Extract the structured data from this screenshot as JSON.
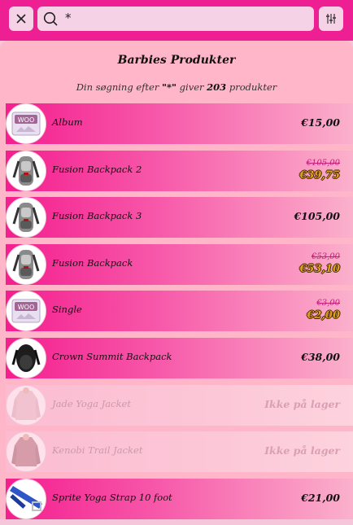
{
  "search": {
    "value": "*"
  },
  "header": {
    "title": "Barbies Produkter",
    "result_prefix": "Din søgning efter",
    "query_quoted": "\"*\"",
    "result_mid": "giver",
    "result_count": "203",
    "result_suffix": "produkter"
  },
  "products": [
    {
      "name": "Album",
      "price": "€15,00",
      "image": "woo-placeholder-image"
    },
    {
      "name": "Fusion Backpack 2",
      "old_price": "€105,00",
      "sale_price": "€39,75",
      "image": "backpack-image"
    },
    {
      "name": "Fusion Backpack 3",
      "price": "€105,00",
      "image": "backpack-image"
    },
    {
      "name": "Fusion Backpack",
      "old_price": "€53,00",
      "sale_price": "€53,10",
      "image": "backpack-image"
    },
    {
      "name": "Single",
      "old_price": "€3,00",
      "sale_price": "€2,00",
      "image": "woo-placeholder-image"
    },
    {
      "name": "Crown Summit Backpack",
      "price": "€38,00",
      "image": "black-backpack-image"
    },
    {
      "name": "Jade Yoga Jacket",
      "stock": "Ikke på lager",
      "image": "jacket-image"
    },
    {
      "name": "Kenobi Trail Jacket",
      "stock": "Ikke på lager",
      "image": "jacket-image"
    },
    {
      "name": "Sprite Yoga Strap 10 foot",
      "price": "€21,00",
      "image": "yoga-strap-image"
    }
  ]
}
